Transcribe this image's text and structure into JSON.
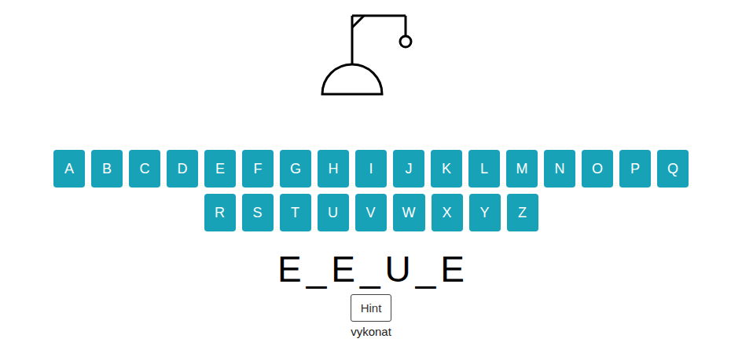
{
  "keyboard": {
    "rows": [
      [
        "A",
        "B",
        "C",
        "D",
        "E",
        "F",
        "G",
        "H",
        "I",
        "J",
        "K",
        "L",
        "M",
        "N",
        "O",
        "P",
        "Q"
      ],
      [
        "R",
        "S",
        "T",
        "U",
        "V",
        "W",
        "X",
        "Y",
        "Z"
      ]
    ]
  },
  "word": {
    "slots": [
      "E",
      "_",
      "E",
      "_",
      "U",
      "_",
      "E"
    ]
  },
  "hint": {
    "label": "Hint",
    "text": "vykonat"
  }
}
